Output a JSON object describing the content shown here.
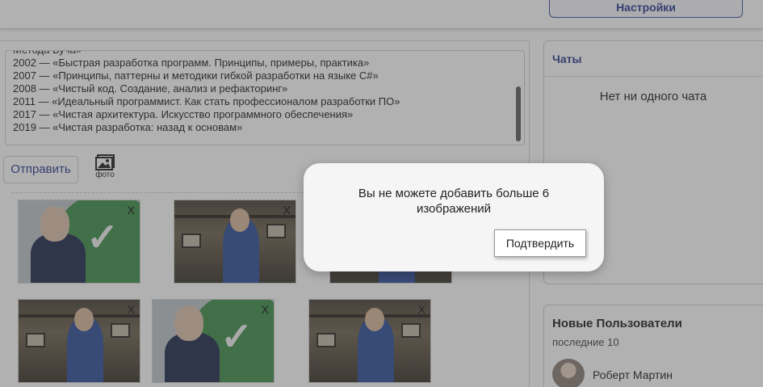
{
  "header": {
    "settings_label": "Настройки"
  },
  "bio": {
    "cut_line": "Метода Буча»",
    "lines": [
      "2002 — «Быстрая разработка программ. Принципы, примеры, практика»",
      "2007 — «Принципы, паттерны и методики гибкой разработки на языке C#»",
      "2008 — «Чистый код. Создание, анализ и рефакторинг»",
      "2011 — «Идеальный программист. Как стать профессионалом разработки ПО»",
      "2017 — «Чистая архитектура. Искусство программного обеспечения»",
      "2019 — «Чистая разработка: назад к основам»"
    ]
  },
  "composer": {
    "send_label": "Отправить",
    "photo_label": "фото",
    "photo_icon": "image-icon"
  },
  "gallery": {
    "remove_label": "X",
    "count": 6
  },
  "chats": {
    "title": "Чаты",
    "empty_text": "Нет ни одного чата"
  },
  "users": {
    "title": "Новые Пользователи",
    "subtitle": "последние 10",
    "items": [
      {
        "name": "Роберт Мартин"
      }
    ]
  },
  "modal": {
    "message": "Вы не можете добавить больше 6 изображений",
    "confirm_label": "Подтвердить"
  },
  "colors": {
    "accent": "#2c3b8f",
    "overlay": "#464646",
    "modal_bg": "#f5f5f5"
  }
}
